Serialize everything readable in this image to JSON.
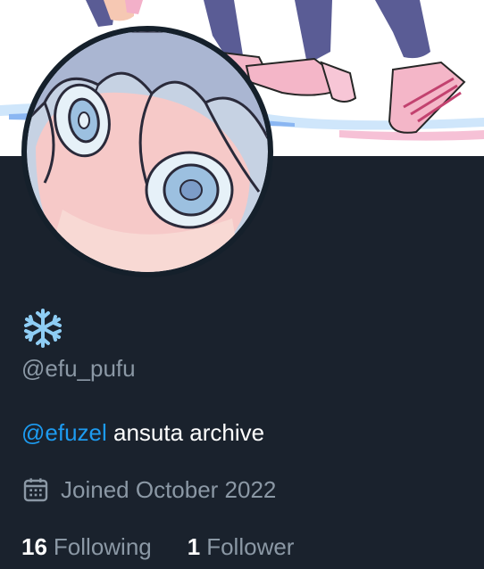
{
  "profile": {
    "display_name_icon": "snowflake-icon",
    "handle": "@efu_pufu",
    "bio": {
      "mention": "@efuzel",
      "text": "ansuta archive"
    },
    "joined": {
      "icon": "calendar-icon",
      "text": "Joined October 2022"
    },
    "stats": {
      "following_count": "16",
      "following_label": "Following",
      "followers_count": "1",
      "followers_label": "Follower"
    }
  },
  "colors": {
    "background": "#15202b",
    "accent": "#1d9bf0",
    "muted_text": "#8b98a5",
    "snowflake": "#8ecdf4"
  }
}
